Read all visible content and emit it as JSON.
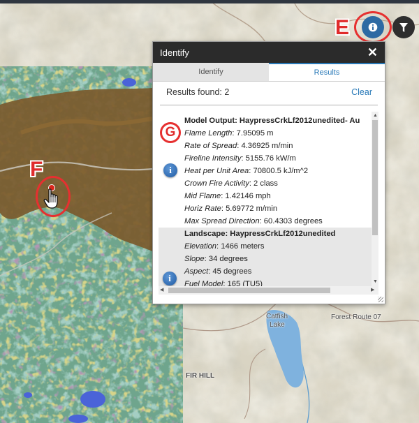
{
  "callouts": {
    "e": "E",
    "f": "F",
    "g": "G"
  },
  "map": {
    "labels": {
      "catfish": "Catfish",
      "lake": "Lake",
      "forest_route": "Forest Route 07",
      "fir_hill": "FIR HILL"
    }
  },
  "map_buttons": {
    "info_icon": "info-icon",
    "filter_icon": "filter-icon"
  },
  "panel": {
    "title": "Identify",
    "close": "✕",
    "tabs": [
      {
        "label": "Identify"
      },
      {
        "label": "Results"
      }
    ],
    "results_found": "Results found: 2",
    "clear": "Clear",
    "result1": {
      "header": "Model Output: HaypressCrkLf2012unedited- Au",
      "attrs": [
        {
          "k": "Flame Length",
          "v": ": 7.95095 m"
        },
        {
          "k": "Rate of Spread",
          "v": ": 4.36925 m/min"
        },
        {
          "k": "Fireline Intensity",
          "v": ": 5155.76 kW/m"
        },
        {
          "k": "Heat per Unit Area",
          "v": ": 70800.5 kJ/m^2"
        },
        {
          "k": "Crown Fire Activity",
          "v": ": 2 class"
        },
        {
          "k": "Mid Flame",
          "v": ": 1.42146 mph"
        },
        {
          "k": "Horiz Rate",
          "v": ": 5.69772 m/min"
        },
        {
          "k": "Max Spread Direction",
          "v": ": 60.4303 degrees"
        }
      ]
    },
    "result2": {
      "header": "Landscape: HaypressCrkLf2012unedited",
      "attrs": [
        {
          "k": "Elevation",
          "v": ": 1466 meters"
        },
        {
          "k": "Slope",
          "v": ": 34 degrees"
        },
        {
          "k": "Aspect",
          "v": ": 45 degrees"
        },
        {
          "k": "Fuel Model",
          "v": ": 165 (TU5)"
        }
      ]
    },
    "icons": {
      "info": "i"
    }
  },
  "colors": {
    "accent": "#2a7ab8",
    "callout": "#e02b2b",
    "header": "#2b2b2b"
  }
}
